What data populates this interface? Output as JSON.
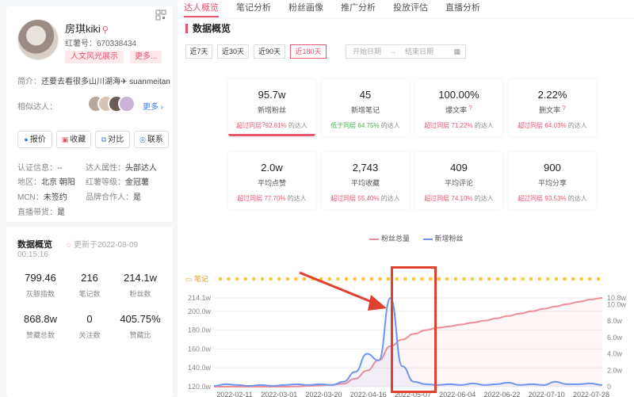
{
  "sidebar": {
    "name": "房琪kiki",
    "red_id": "红薯号：670338434",
    "tag": "人文风光展示",
    "tag_more": "更多...",
    "intro_label": "简介：",
    "intro_text": "还要去看很多山川湖海✈ suanmeitan",
    "similar_label": "相似达人：",
    "similar_more": "更多",
    "actions": [
      {
        "icon": "quote-icon",
        "label": "报价"
      },
      {
        "icon": "star-icon",
        "label": "收藏"
      },
      {
        "icon": "compare-icon",
        "label": "对比"
      },
      {
        "icon": "contact-icon",
        "label": "联系"
      }
    ],
    "info": {
      "cert_k": "认证信息：",
      "cert_v": "--",
      "attr_k": "达人属性：",
      "attr_v": "头部达人",
      "region_k": "地区：",
      "region_v": "北京 朝阳",
      "level_k": "红薯等级：",
      "level_v": "金冠薯",
      "mcn_k": "MCN：",
      "mcn_v": "未签约",
      "brand_k": "品牌合作人：",
      "brand_v": "是",
      "live_k": "直播带货：",
      "live_v": "是"
    },
    "stats_title": "数据概览",
    "stats_update": "更新于2022-08-09",
    "stats_time": "00:15:16",
    "metrics": [
      {
        "value": "799.46",
        "label": "灰豚指数"
      },
      {
        "value": "216",
        "label": "笔记数"
      },
      {
        "value": "214.1w",
        "label": "粉丝数"
      },
      {
        "value": "868.8w",
        "label": "赞藏总数"
      },
      {
        "value": "0",
        "label": "关注数"
      },
      {
        "value": "405.75%",
        "label": "赞藏比"
      }
    ]
  },
  "tabs": [
    "达人概览",
    "笔记分析",
    "粉丝画像",
    "推广分析",
    "投放评估",
    "直播分析"
  ],
  "section_title": "数据概览",
  "ranges": [
    "近7天",
    "近30天",
    "近90天",
    "近180天"
  ],
  "date_start": "开始日期",
  "date_sep": "→",
  "date_end": "结束日期",
  "cards": [
    {
      "value": "95.7w",
      "label": "新增粉丝",
      "prefix": "超过同层",
      "pct": "92.81%",
      "suffix": "的达人",
      "trend": "hi"
    },
    {
      "value": "45",
      "label": "新增笔记",
      "prefix": "低于同层",
      "pct": "64.75%",
      "suffix": "的达人",
      "trend": "lo"
    },
    {
      "value": "100.00%",
      "label": "爆文率",
      "prefix": "超过同层",
      "pct": "71.22%",
      "suffix": "的达人",
      "trend": "hi"
    },
    {
      "value": "2.22%",
      "label": "删文率",
      "prefix": "超过同层",
      "pct": "64.03%",
      "suffix": "的达人",
      "trend": "hi"
    },
    {
      "value": "2.0w",
      "label": "平均点赞",
      "prefix": "超过同层",
      "pct": "77.70%",
      "suffix": "的达人",
      "trend": "hi"
    },
    {
      "value": "2,743",
      "label": "平均收藏",
      "prefix": "超过同层",
      "pct": "55.40%",
      "suffix": "的达人",
      "trend": "hi"
    },
    {
      "value": "409",
      "label": "平均评论",
      "prefix": "超过同层",
      "pct": "74.10%",
      "suffix": "的达人",
      "trend": "hi"
    },
    {
      "value": "900",
      "label": "平均分享",
      "prefix": "超过同层",
      "pct": "93.53%",
      "suffix": "的达人",
      "trend": "hi"
    }
  ],
  "colors": {
    "accent": "#e5566f",
    "total_line": "#f08c96",
    "new_line": "#6e96f0",
    "note_dot": "#f5c842",
    "annotation": "#e0402f"
  },
  "chart_data": {
    "type": "line",
    "note_label": "笔记",
    "legend": [
      "粉丝总量",
      "新增粉丝"
    ],
    "x_ticks": [
      "2022-02-11",
      "2022-03-01",
      "2022-03-20",
      "2022-04-16",
      "2022-05-07",
      "2022-06-04",
      "2022-06-22",
      "2022-07-10",
      "2022-07-28"
    ],
    "y_left_ticks": [
      "120.0w",
      "140.0w",
      "160.0w",
      "180.0w",
      "200.0w",
      "214.1w"
    ],
    "y_right_ticks": [
      "0",
      "2.0w",
      "4.0w",
      "6.0w",
      "8.0w",
      "10.0w",
      "10.8w"
    ],
    "ylim_left": [
      120.0,
      214.1
    ],
    "ylim_right": [
      0,
      10.8
    ],
    "series": [
      {
        "name": "粉丝总量",
        "axis": "left",
        "values": [
          118.4,
          118.6,
          118.8,
          119.0,
          119.3,
          119.6,
          119.9,
          120.3,
          120.8,
          121.4,
          122.0,
          123.2,
          128.5,
          137.0,
          148.0,
          163.0,
          170.0,
          176.0,
          180.0,
          182.5,
          184.0,
          186.0,
          188.0,
          190.0,
          192.5,
          195.0,
          197.5,
          200.0,
          202.5,
          205.0,
          207.5,
          210.0,
          212.5,
          214.1
        ]
      },
      {
        "name": "新增粉丝",
        "axis": "right",
        "values": [
          0.1,
          0.3,
          0.2,
          0.1,
          0.2,
          0.1,
          0.2,
          0.3,
          0.2,
          0.3,
          0.2,
          0.6,
          1.8,
          4.0,
          3.2,
          10.8,
          2.5,
          0.6,
          0.3,
          0.2,
          0.3,
          0.2,
          0.4,
          0.2,
          0.3,
          0.5,
          0.2,
          0.3,
          0.2,
          0.6,
          0.3,
          0.3,
          0.4,
          0.2
        ]
      }
    ]
  }
}
